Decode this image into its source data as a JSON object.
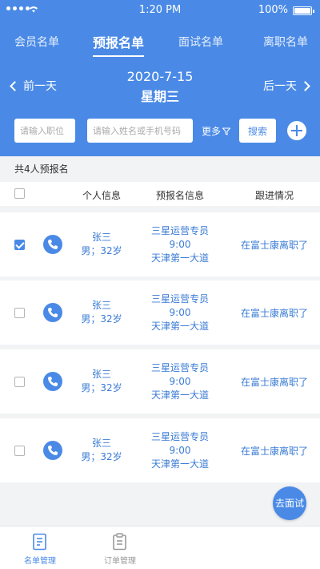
{
  "status_bar": {
    "time": "1:20 PM",
    "battery": "100%"
  },
  "tabs": [
    {
      "label": "会员名单",
      "active": false
    },
    {
      "label": "预报名单",
      "active": true
    },
    {
      "label": "面试名单",
      "active": false
    },
    {
      "label": "离职名单",
      "active": false
    }
  ],
  "datebar": {
    "prev": "前一天",
    "next": "后一天",
    "date": "2020-7-15",
    "weekday": "星期三"
  },
  "filters": {
    "position_placeholder": "请输入职位",
    "name_placeholder": "请输入姓名或手机号码",
    "more": "更多",
    "search": "搜索"
  },
  "summary": "共4人预报名",
  "columns": {
    "personal": "个人信息",
    "signup": "预报名信息",
    "followup": "跟进情况"
  },
  "rows": [
    {
      "checked": true,
      "name": "张三",
      "detail": "男；32岁",
      "job": "三星运营专员",
      "time": "9:00",
      "place": "天津第一大道",
      "follow": "在富士康离职了"
    },
    {
      "checked": false,
      "name": "张三",
      "detail": "男；32岁",
      "job": "三星运营专员",
      "time": "9:00",
      "place": "天津第一大道",
      "follow": "在富士康离职了"
    },
    {
      "checked": false,
      "name": "张三",
      "detail": "男；32岁",
      "job": "三星运营专员",
      "time": "9:00",
      "place": "天津第一大道",
      "follow": "在富士康离职了"
    },
    {
      "checked": false,
      "name": "张三",
      "detail": "男；32岁",
      "job": "三星运营专员",
      "time": "9:00",
      "place": "天津第一大道",
      "follow": "在富士康离职了"
    }
  ],
  "go_interview": "去面试",
  "bottom_nav": [
    {
      "label": "名单管理",
      "active": true
    },
    {
      "label": "订单管理",
      "active": false
    }
  ],
  "colors": {
    "primary": "#4a8ae6",
    "link": "#3a7bd5",
    "background": "#f2f3f5"
  }
}
